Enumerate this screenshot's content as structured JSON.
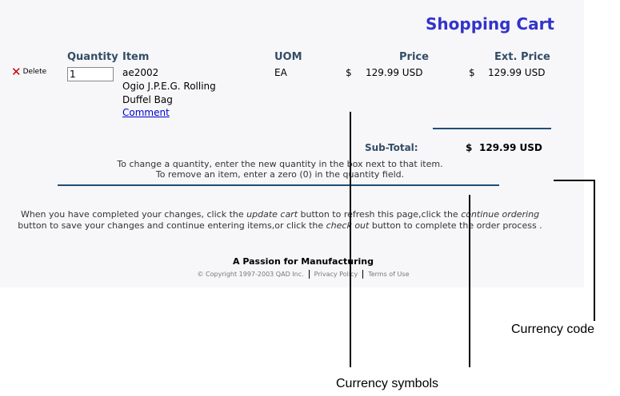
{
  "page": {
    "title": "Shopping Cart"
  },
  "columns": {
    "quantity": "Quantity",
    "item": "Item",
    "uom": "UOM",
    "price": "Price",
    "ext_price": "Ext. Price"
  },
  "row": {
    "delete_label": "Delete",
    "quantity_value": "1",
    "item_code": "ae2002",
    "item_desc_line1": "Ogio J.P.E.G. Rolling",
    "item_desc_line2": "Duffel Bag",
    "comment_link": "Comment",
    "uom": "EA",
    "price_symbol": "$",
    "price_value": "129.99 USD",
    "ext_symbol": "$",
    "ext_value": "129.99 USD"
  },
  "subtotal": {
    "label": "Sub-Total:",
    "symbol": "$",
    "value": "129.99 USD"
  },
  "instructions": {
    "line1": "To change a quantity, enter the new quantity in the box next to that item.",
    "line2": "To remove an item, enter a zero (0) in the quantity field."
  },
  "help_text": {
    "part1": "When you have completed your changes, click the ",
    "update_cart": "update cart",
    "part2": " button to refresh this page,click the ",
    "continue_ordering": "continue ordering",
    "part3": " button to save your changes and continue entering items,or click the ",
    "check_out": "check out",
    "part4": " button to complete the order process ."
  },
  "footer": {
    "tagline": "A Passion for Manufacturing",
    "copyright": "© Copyright 1997-2003 QAD Inc.",
    "privacy": "Privacy Policy",
    "terms": "Terms of Use"
  },
  "annotations": {
    "currency_code": "Currency code",
    "currency_symbols": "Currency symbols"
  }
}
